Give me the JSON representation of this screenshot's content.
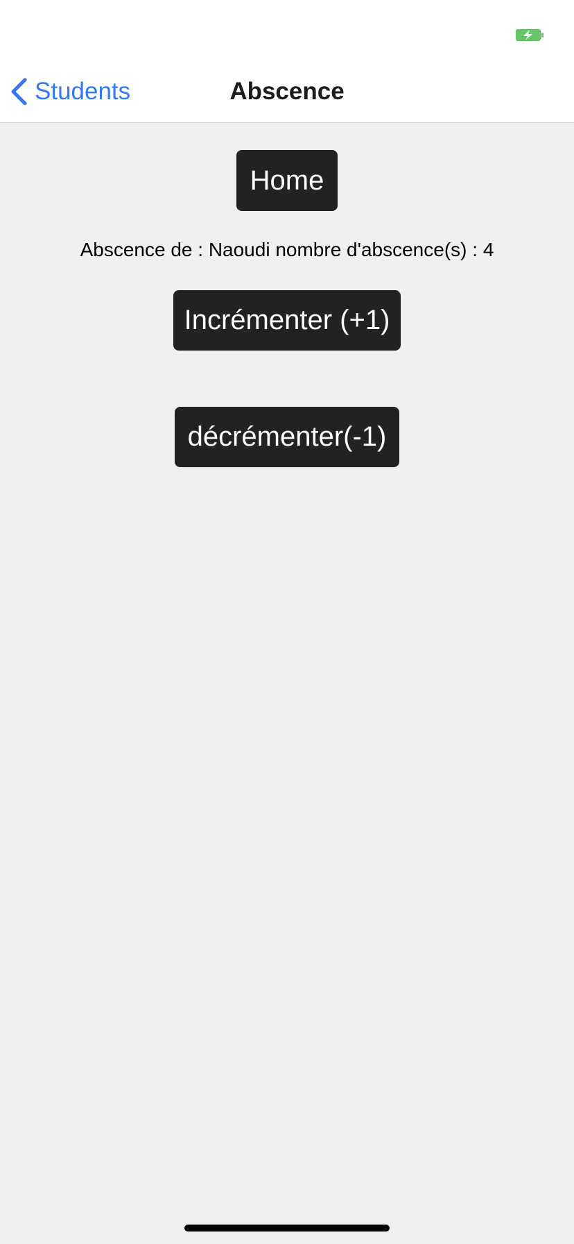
{
  "colors": {
    "background": "#f0f0f0",
    "bar_background": "#ffffff",
    "accent": "#3478f6",
    "button_background": "#222222",
    "button_text": "#ffffff",
    "battery": "#65c466"
  },
  "status_bar": {
    "battery_icon": "battery-charging-icon"
  },
  "nav": {
    "back_label": "Students",
    "back_icon": "chevron-left-icon",
    "title": "Abscence"
  },
  "main": {
    "home_label": "Home",
    "absence_text": "Abscence de : Naoudi nombre d'abscence(s) : 4",
    "increment_label": "Incrémenter (+1)",
    "decrement_label": "décrémenter(-1)"
  }
}
